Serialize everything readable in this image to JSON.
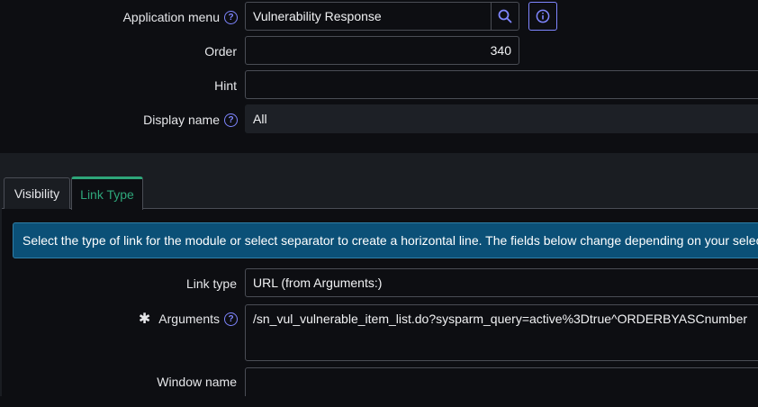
{
  "form": {
    "application_menu": {
      "label": "Application menu",
      "value": "Vulnerability Response"
    },
    "order": {
      "label": "Order",
      "value": "340"
    },
    "hint": {
      "label": "Hint",
      "value": ""
    },
    "display_name": {
      "label": "Display name",
      "value": "All"
    }
  },
  "tabs": [
    {
      "label": "Visibility",
      "active": false
    },
    {
      "label": "Link Type",
      "active": true
    }
  ],
  "link_type_section": {
    "info_text": "Select the type of link for the module or select separator to create a horizontal line. The fields below change depending on your selection",
    "link_type": {
      "label": "Link type",
      "value": "URL (from Arguments:)"
    },
    "arguments": {
      "label": "Arguments",
      "required_mark": "✱",
      "value": "/sn_vul_vulnerable_item_list.do?sysparm_query=active%3Dtrue^ORDERBYASCnumber"
    },
    "window_name": {
      "label": "Window name",
      "value": ""
    }
  },
  "colors": {
    "accent": "#7f86ff",
    "active_tab": "#2ea67a",
    "info_banner": "#0b5077"
  },
  "icons": {
    "help": "question-circle-icon",
    "search": "magnifier-icon",
    "info": "info-circle-icon"
  }
}
